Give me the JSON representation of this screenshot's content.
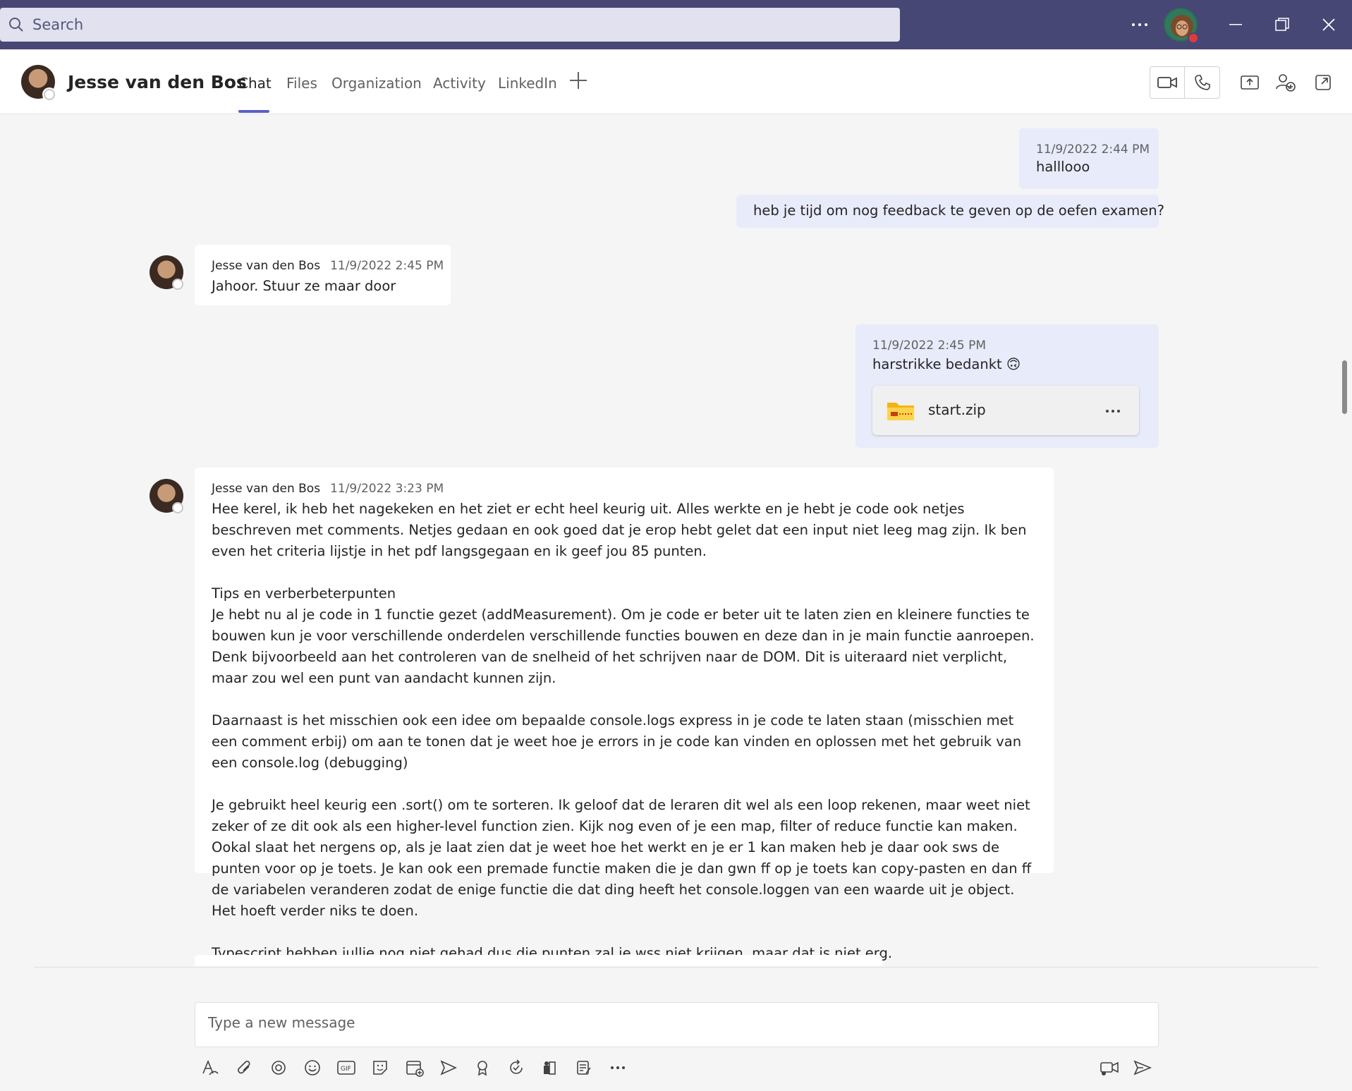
{
  "search": {
    "placeholder": "Search"
  },
  "header": {
    "contact_name": "Jesse van den Bos",
    "tabs": [
      {
        "label": "Chat",
        "active": true
      },
      {
        "label": "Files"
      },
      {
        "label": "Organization"
      },
      {
        "label": "Activity"
      },
      {
        "label": "LinkedIn"
      }
    ]
  },
  "messages": {
    "m1": {
      "timestamp": "11/9/2022 2:44 PM",
      "text": "halllooo"
    },
    "m2": {
      "text": "heb je tijd om nog feedback te geven op de oefen examen?"
    },
    "m3": {
      "sender": "Jesse van den Bos",
      "timestamp": "11/9/2022 2:45 PM",
      "text": "Jahoor. Stuur ze maar door"
    },
    "m4": {
      "timestamp": "11/9/2022 2:45 PM",
      "text": "harstrikke bedankt 🙃",
      "file_name": "start.zip"
    },
    "m5": {
      "sender": "Jesse van den Bos",
      "timestamp": "11/9/2022 3:23 PM",
      "p1": "Hee kerel, ik heb het nagekeken en het ziet er echt heel keurig uit. Alles werkte en je hebt je code ook netjes beschreven met comments. Netjes gedaan en ook goed dat je erop hebt gelet dat een input niet leeg mag zijn. Ik ben even het criteria lijstje in het pdf langsgegaan en ik geef jou 85 punten.",
      "p2_title": "Tips en verberbeterpunten",
      "p2": "Je hebt nu al je code in 1 functie gezet (addMeasurement). Om je code er beter uit te laten zien en kleinere functies te bouwen kun je voor verschillende onderdelen verschillende functies bouwen en deze dan in je main functie aanroepen. Denk bijvoorbeeld aan het controleren van de snelheid of het schrijven naar de DOM. Dit is uiteraard niet verplicht, maar zou wel een punt van aandacht kunnen zijn.",
      "p3": "Daarnaast is het misschien ook een idee om bepaalde console.logs express in je code te laten staan (misschien met een comment erbij) om aan te tonen dat je weet hoe je errors in je code kan vinden en oplossen met het gebruik van een console.log (debugging)",
      "p4": "Je gebruikt heel keurig een .sort() om te sorteren. Ik geloof dat de leraren dit wel als een loop rekenen, maar weet niet zeker of ze dit ook als een higher-level function zien. Kijk nog even of je een map, filter of reduce functie kan maken. Ookal slaat het nergens op, als je laat zien dat je weet hoe het werkt en je er 1 kan maken heb je daar ook sws de punten voor op je toets. Je kan ook een premade functie maken die je dan gwn ff op je toets kan copy-pasten en dan ff de variabelen veranderen zodat de enige functie die dat ding heeft het console.loggen van een waarde uit je object. Het hoeft verder niks te doen.",
      "p5": "Typescript hebben jullie nog niet gehad dus die punten zal je wss niet krijgen, maar dat is niet erg."
    }
  },
  "compose": {
    "placeholder": "Type a new message"
  },
  "colors": {
    "titlebar": "#464775",
    "accent": "#5b5fc7",
    "my_bubble": "#e8ebfa"
  },
  "icons": [
    "search-icon",
    "more-icon",
    "minimize-icon",
    "restore-icon",
    "close-icon",
    "video-call-icon",
    "audio-call-icon",
    "share-screen-icon",
    "add-people-icon",
    "pop-out-icon",
    "add-tab-icon",
    "zip-file-icon",
    "format-icon",
    "attach-icon",
    "loop-icon",
    "emoji-icon",
    "gif-icon",
    "sticker-icon",
    "schedule-meeting-icon",
    "stream-icon",
    "praise-icon",
    "updates-icon",
    "approvals-icon",
    "forms-icon",
    "more-options-icon",
    "meet-now-icon",
    "send-icon"
  ]
}
